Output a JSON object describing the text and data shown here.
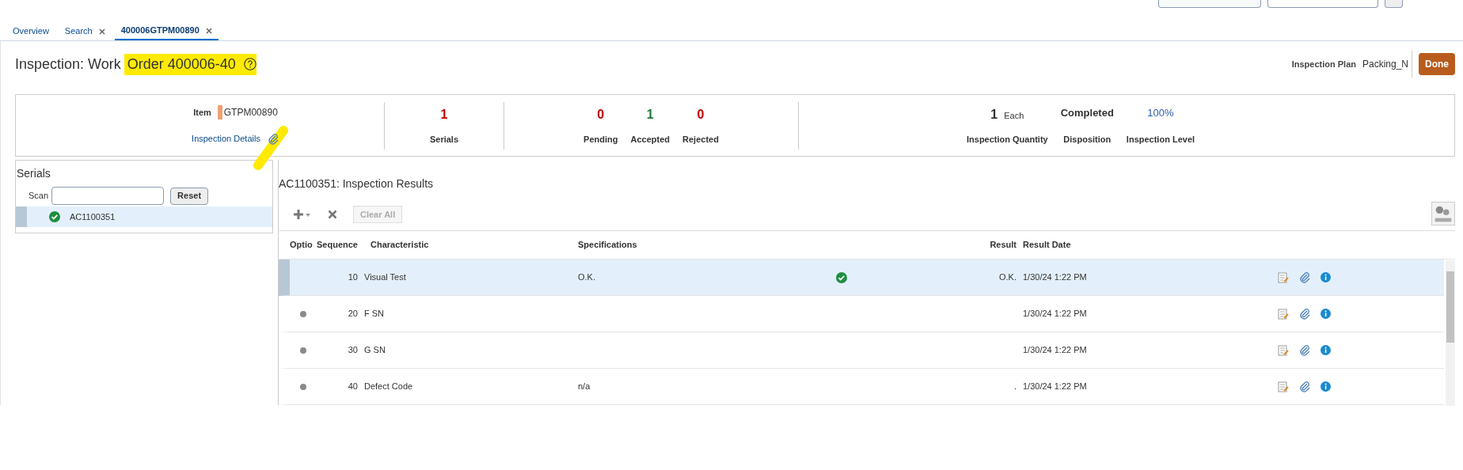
{
  "tabs": [
    {
      "label": "Overview",
      "selected": false,
      "closable": false
    },
    {
      "label": "Search",
      "selected": false,
      "closable": true
    },
    {
      "label": "400006GTPM00890",
      "selected": true,
      "closable": true
    }
  ],
  "header": {
    "title": "Inspection: Work",
    "highlighted": "Order 400006-40",
    "plan_label": "Inspection Plan",
    "plan_value": "Packing_N",
    "done": "Done"
  },
  "summary": {
    "item_label": "Item",
    "item_value": "GTPM00890",
    "details_link": "Inspection Details",
    "serials_count": "1",
    "serials_label": "Serials",
    "counts": [
      {
        "value": "0",
        "label": "Pending",
        "color": "#c00000"
      },
      {
        "value": "1",
        "label": "Accepted",
        "color": "#1e7a3a"
      },
      {
        "value": "0",
        "label": "Rejected",
        "color": "#c00000"
      }
    ],
    "quantity": "1",
    "uom": "Each",
    "quantity_label": "Inspection Quantity",
    "disposition": "Completed",
    "disposition_label": "Disposition",
    "level": "100%",
    "level_label": "Inspection Level"
  },
  "serials": {
    "title": "Serials",
    "scan_label": "Scan",
    "reset": "Reset",
    "items": [
      {
        "serial": "AC1100351",
        "selected": true,
        "passed": true
      }
    ]
  },
  "results": {
    "title": "AC1100351: Inspection Results",
    "clear_all": "Clear All",
    "columns": [
      "Optio",
      "Sequence",
      "Characteristic",
      "Specifications",
      "Result",
      "Result Date"
    ],
    "rows": [
      {
        "selected": true,
        "pending": false,
        "sequence": "10",
        "characteristic": "Visual Test",
        "specifications": "O.K.",
        "passed": true,
        "result": "O.K.",
        "date": "1/30/24 1:22 PM"
      },
      {
        "selected": false,
        "pending": true,
        "sequence": "20",
        "characteristic": "F SN",
        "specifications": "",
        "passed": false,
        "result": "",
        "date": "1/30/24 1:22 PM"
      },
      {
        "selected": false,
        "pending": true,
        "sequence": "30",
        "characteristic": "G SN",
        "specifications": "",
        "passed": false,
        "result": "",
        "date": "1/30/24 1:22 PM"
      },
      {
        "selected": false,
        "pending": true,
        "sequence": "40",
        "characteristic": "Defect Code",
        "specifications": "n/a",
        "passed": false,
        "result": ".",
        "date": "1/30/24 1:22 PM"
      }
    ]
  }
}
